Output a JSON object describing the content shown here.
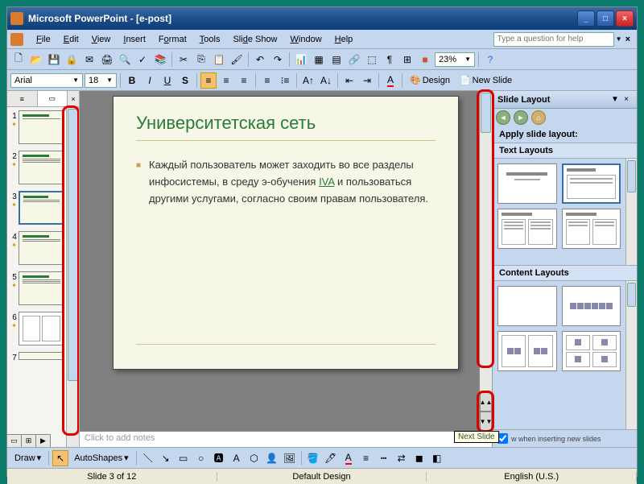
{
  "app": {
    "name": "Microsoft PowerPoint",
    "document": "[e-post]",
    "title_full": "Microsoft PowerPoint - [e-post]"
  },
  "menus": {
    "file": "File",
    "edit": "Edit",
    "view": "View",
    "insert": "Insert",
    "format": "Format",
    "tools": "Tools",
    "slideshow": "Slide Show",
    "window": "Window",
    "help": "Help"
  },
  "help_placeholder": "Type a question for help",
  "zoom": "23%",
  "format_bar": {
    "font": "Arial",
    "size": "18",
    "design_label": "Design",
    "new_slide_label": "New Slide"
  },
  "thumb_tabs": {
    "outline": "≡",
    "slides": "▭",
    "close": "×"
  },
  "thumbnails": {
    "count": 7,
    "selected": 3
  },
  "slide": {
    "title": "Университетская сеть",
    "body_pre": "Каждый пользователь может заходить во все разделы инфосистемы, в среду э-обучения ",
    "link": "IVA",
    "body_post": " и пользоваться другими услугами, согласно своим правам пользователя."
  },
  "notes_placeholder": "Click to add notes",
  "task_pane": {
    "title": "Slide Layout",
    "apply_label": "Apply slide layout:",
    "section_text": "Text Layouts",
    "section_content": "Content Layouts",
    "footer_checkbox": "Show when inserting new slides"
  },
  "tooltip": "Next Slide",
  "draw": {
    "label": "Draw",
    "autoshapes": "AutoShapes"
  },
  "status": {
    "slide": "Slide 3 of 12",
    "design": "Default Design",
    "lang": "English (U.S.)"
  }
}
